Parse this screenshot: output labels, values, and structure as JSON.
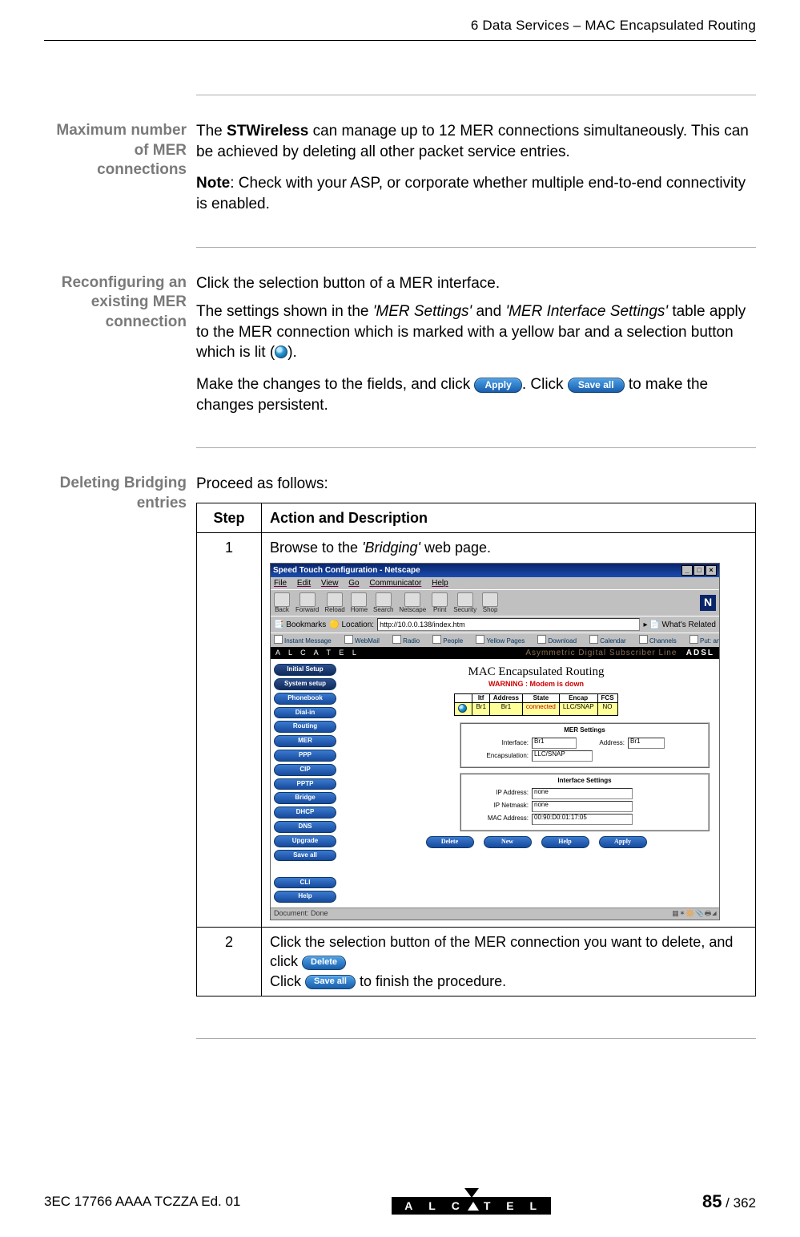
{
  "header": {
    "running": "6   Data Services – MAC Encapsulated Routing"
  },
  "sections": {
    "max": {
      "label": "Maximum number of MER connections",
      "p1a": "The ",
      "p1b": "STWireless",
      "p1c": " can manage up to 12 MER connections simultaneously. This can be achieved by deleting all other packet service entries.",
      "note_label": "Note",
      "note_rest": ": Check with your ASP, or corporate whether multiple end-to-end connectivity is enabled."
    },
    "reconf": {
      "label": "Reconfiguring an existing MER connection",
      "p1": "Click the selection button of a MER interface.",
      "p2a": "The settings shown in the ",
      "p2b": "'MER Settings'",
      "p2c": " and ",
      "p2d": "'MER Interface Settings'",
      "p2e": " table apply to the MER connection which is marked with a yellow bar and a selection button which is lit (",
      "p2f": ").",
      "p3a": "Make the changes to the fields, and click ",
      "p3b": ". Click ",
      "p3c": " to make the changes persistent.",
      "btn_apply": "Apply",
      "btn_saveall": "Save all"
    },
    "del": {
      "label": "Deleting Bridging entries",
      "intro": "Proceed as follows:",
      "col_step": "Step",
      "col_action": "Action and Description",
      "row1_num": "1",
      "row1_a": "Browse to the ",
      "row1_b": "'Bridging'",
      "row1_c": " web page.",
      "row2_num": "2",
      "row2_a": "Click the selection button of the MER connection you want to delete, and click ",
      "row2_b": "Click ",
      "row2_c": " to finish the procedure.",
      "btn_delete": "Delete",
      "btn_saveall2": "Save all"
    }
  },
  "screenshot": {
    "title": "Speed Touch Configuration - Netscape",
    "menus": [
      "File",
      "Edit",
      "View",
      "Go",
      "Communicator",
      "Help"
    ],
    "toolbar": [
      "Back",
      "Forward",
      "Reload",
      "Home",
      "Search",
      "Netscape",
      "Print",
      "Security",
      "Shop"
    ],
    "location_label": "Bookmarks",
    "location_prefix": "Location:",
    "url": "http://10.0.0.138/index.htm",
    "whats_related": "What's Related",
    "linkbar": [
      "Instant Message",
      "WebMail",
      "Radio",
      "People",
      "Yellow Pages",
      "Download",
      "Calendar",
      "Channels",
      "Put: andere stuf"
    ],
    "brand": "A L C A T E L",
    "adsl_over": "Asymmetric Digital Subscriber Line",
    "adsl": "ADSL",
    "sidebar": [
      "Initial Setup",
      "System setup",
      "Phonebook",
      "Dial-in",
      "Routing",
      "MER",
      "PPP",
      "CIP",
      "PPTP",
      "Bridge",
      "DHCP",
      "DNS",
      "Upgrade",
      "Save all"
    ],
    "sidebar_bottom": [
      "CLI",
      "Help"
    ],
    "main_title": "MAC Encapsulated Routing",
    "warning": "WARNING : Modem is down",
    "tbl_headers": [
      "Itf",
      "Address",
      "State",
      "Encap",
      "FCS"
    ],
    "tbl_row": [
      "Br1",
      "Br1",
      "connected",
      "LLC/SNAP",
      "NO"
    ],
    "mer_settings_title": "MER Settings",
    "mer_if_label": "Interface:",
    "mer_if_val": "Br1",
    "mer_addr_label": "Address:",
    "mer_addr_val": "Br1",
    "mer_encap_label": "Encapsulation:",
    "mer_encap_val": "LLC/SNAP",
    "itf_settings_title": "Interface Settings",
    "itf_ip_label": "IP Address:",
    "itf_ip_val": "none",
    "itf_mask_label": "IP Netmask:",
    "itf_mask_val": "none",
    "itf_mac_label": "MAC Address:",
    "itf_mac_val": "00:90:D0:01:17:05",
    "btns": [
      "Delete",
      "New",
      "Help",
      "Apply"
    ],
    "status": "Document: Done"
  },
  "footer": {
    "docnum": "3EC 17766 AAAA TCZZA Ed. 01",
    "brand_letters": "ALC TEL",
    "page_cur": "85",
    "page_sep": " / ",
    "page_total": "362"
  }
}
